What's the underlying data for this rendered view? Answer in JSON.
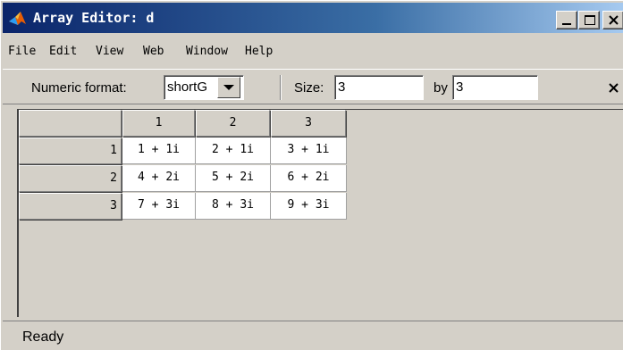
{
  "window": {
    "title": "Array Editor: d"
  },
  "menu": {
    "items": [
      "File",
      "Edit",
      "View",
      "Web",
      "Window",
      "Help"
    ]
  },
  "toolbar": {
    "numeric_format_label": "Numeric format:",
    "numeric_format_value": "shortG",
    "size_label": "Size:",
    "rows_value": "3",
    "by_label": "by",
    "cols_value": "3"
  },
  "grid": {
    "column_headers": [
      "1",
      "2",
      "3"
    ],
    "rows": [
      {
        "header": "1",
        "cells": [
          "1 + 1i",
          "2 + 1i",
          "3 + 1i"
        ]
      },
      {
        "header": "2",
        "cells": [
          "4 + 2i",
          "5 + 2i",
          "6 + 2i"
        ]
      },
      {
        "header": "3",
        "cells": [
          "7 + 3i",
          "8 + 3i",
          "9 + 3i"
        ]
      }
    ]
  },
  "status": {
    "text": "Ready"
  },
  "icons": {
    "app": "matlab-logo-icon",
    "minimize": "minimize-icon",
    "maximize": "maximize-icon",
    "close": "close-icon",
    "dropdown": "chevron-down-icon",
    "undock": "close-icon"
  },
  "colors": {
    "title_bar_start": "#0a246a",
    "title_bar_end": "#a6caf0",
    "window_face": "#d4d0c8"
  }
}
